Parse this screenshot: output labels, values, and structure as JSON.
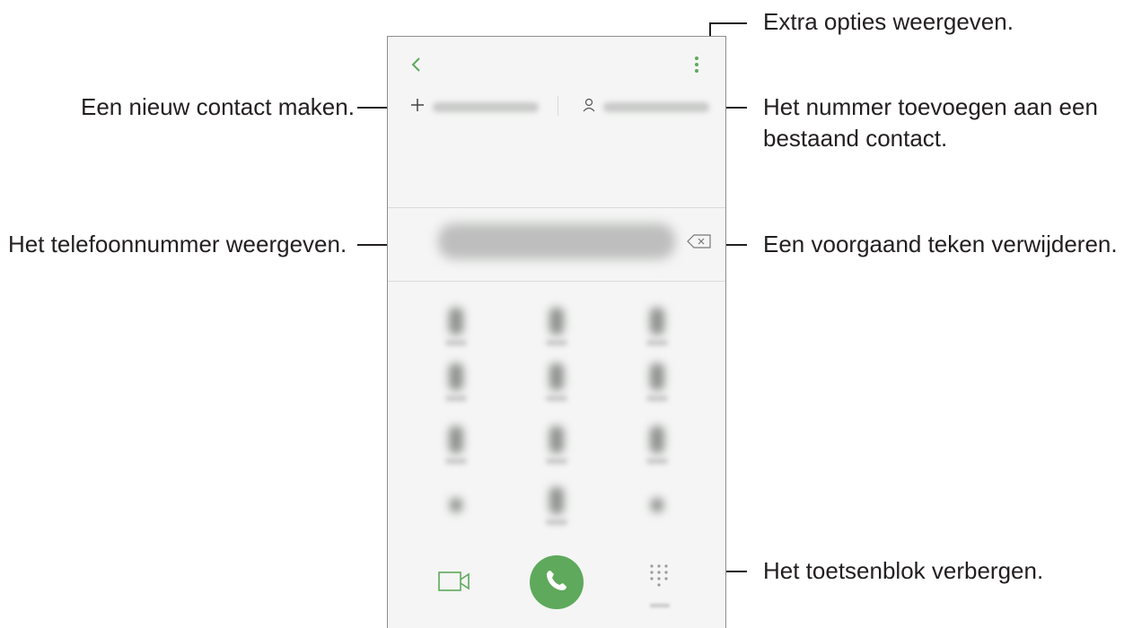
{
  "dialer": {
    "back_icon": "chevron-left-icon",
    "more_icon": "vertical-dots-icon",
    "create_contact_icon": "plus-icon",
    "add_to_contact_icon": "person-icon",
    "backspace_icon": "backspace-icon",
    "video_call_icon": "video-camera-icon",
    "call_icon": "phone-handset-icon",
    "keypad_icon": "keypad-grid-icon",
    "accent_color": "#5ea95b",
    "keys": [
      "1",
      "2",
      "3",
      "4",
      "5",
      "6",
      "7",
      "8",
      "9",
      "*",
      "0",
      "#"
    ]
  },
  "callouts": {
    "more_options": "Extra opties weergeven.",
    "create_contact": "Een nieuw contact maken.",
    "add_to_contact_line1": "Het nummer toevoegen aan een",
    "add_to_contact_line2": "bestaand contact.",
    "show_number": "Het telefoonnummer weergeven.",
    "delete_char": "Een voorgaand teken verwijderen.",
    "hide_keypad": "Het toetsenblok verbergen."
  }
}
